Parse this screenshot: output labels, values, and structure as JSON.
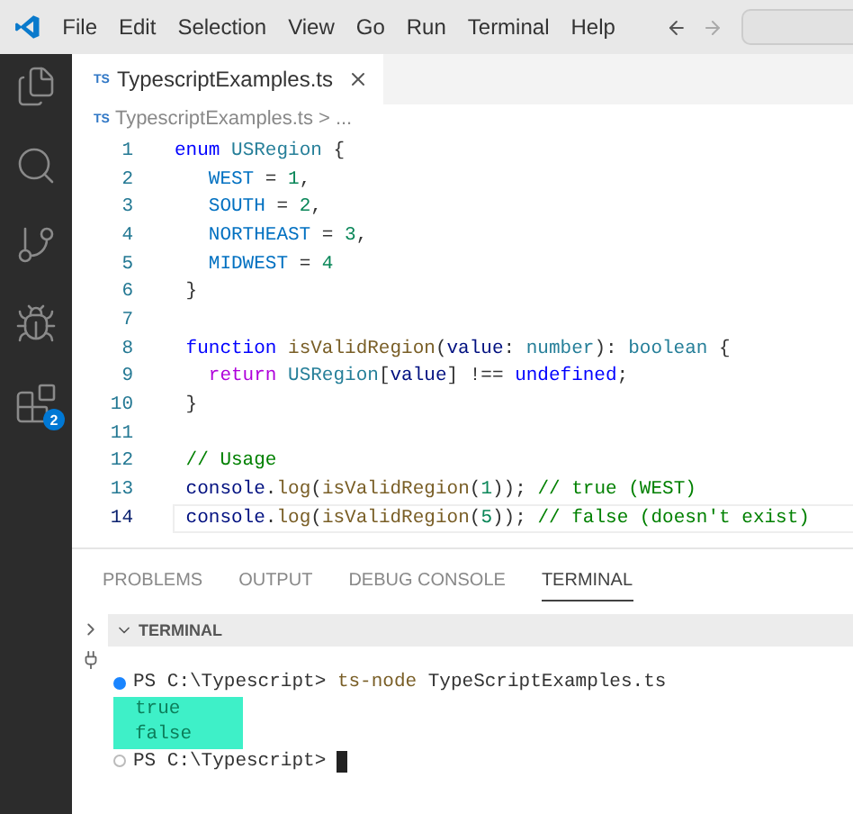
{
  "menu_bar": {
    "items": [
      "File",
      "Edit",
      "Selection",
      "View",
      "Go",
      "Run",
      "Terminal",
      "Help"
    ]
  },
  "activity_bar": {
    "items": [
      {
        "kind": "files",
        "selected": false
      },
      {
        "kind": "search",
        "selected": false
      },
      {
        "kind": "source-control",
        "selected": false
      },
      {
        "kind": "run",
        "selected": false
      },
      {
        "kind": "extensions",
        "selected": false,
        "badge": "2"
      }
    ]
  },
  "editor_tabs": [
    {
      "lang": "TS",
      "label": "TypescriptExamples.ts",
      "selected": true
    }
  ],
  "breadcrumbs": {
    "lang": "TS",
    "items": [
      "TypescriptExamples.ts",
      "..."
    ],
    "separator": ">"
  },
  "code": {
    "lines": [
      {
        "number": "1",
        "active": false,
        "tokens": [
          {
            "kind": "keyword",
            "text": "enum"
          },
          {
            "kind": "type",
            "text": " USRegion"
          },
          {
            "kind": "plain",
            "text": " {"
          }
        ]
      },
      {
        "number": "2",
        "active": false,
        "tokens": [
          {
            "kind": "member",
            "text": "   WEST"
          },
          {
            "kind": "plain",
            "text": " = "
          },
          {
            "kind": "number",
            "text": "1"
          },
          {
            "kind": "plain",
            "text": ","
          }
        ]
      },
      {
        "number": "3",
        "active": false,
        "tokens": [
          {
            "kind": "member",
            "text": "   SOUTH"
          },
          {
            "kind": "plain",
            "text": " = "
          },
          {
            "kind": "number",
            "text": "2"
          },
          {
            "kind": "plain",
            "text": ","
          }
        ]
      },
      {
        "number": "4",
        "active": false,
        "tokens": [
          {
            "kind": "member",
            "text": "   NORTHEAST"
          },
          {
            "kind": "plain",
            "text": " = "
          },
          {
            "kind": "number",
            "text": "3"
          },
          {
            "kind": "plain",
            "text": ","
          }
        ]
      },
      {
        "number": "5",
        "active": false,
        "tokens": [
          {
            "kind": "member",
            "text": "   MIDWEST"
          },
          {
            "kind": "plain",
            "text": " = "
          },
          {
            "kind": "number",
            "text": "4"
          }
        ]
      },
      {
        "number": "6",
        "active": false,
        "tokens": [
          {
            "kind": "plain",
            "text": " }"
          }
        ]
      },
      {
        "number": "7",
        "active": false
      },
      {
        "number": "8",
        "active": false,
        "tokens": [
          {
            "kind": "keyword",
            "text": " function"
          },
          {
            "kind": "function",
            "text": " isValidRegion"
          },
          {
            "kind": "plain",
            "text": "("
          },
          {
            "kind": "variable",
            "text": "value"
          },
          {
            "kind": "plain",
            "text": ": "
          },
          {
            "kind": "type",
            "text": "number"
          },
          {
            "kind": "plain",
            "text": "): "
          },
          {
            "kind": "type",
            "text": "boolean"
          },
          {
            "kind": "plain",
            "text": " {"
          }
        ]
      },
      {
        "number": "9",
        "active": false,
        "tokens": [
          {
            "kind": "control",
            "text": "   return"
          },
          {
            "kind": "type",
            "text": " USRegion"
          },
          {
            "kind": "plain",
            "text": "["
          },
          {
            "kind": "variable",
            "text": "value"
          },
          {
            "kind": "plain",
            "text": "] !== "
          },
          {
            "kind": "keyword",
            "text": "undefined"
          },
          {
            "kind": "plain",
            "text": ";"
          }
        ]
      },
      {
        "number": "10",
        "active": false,
        "tokens": [
          {
            "kind": "plain",
            "text": " }"
          }
        ]
      },
      {
        "number": "11",
        "active": false
      },
      {
        "number": "12",
        "active": false,
        "tokens": [
          {
            "kind": "comment",
            "text": " // Usage"
          }
        ]
      },
      {
        "number": "13",
        "active": false,
        "tokens": [
          {
            "kind": "variable",
            "text": " console"
          },
          {
            "kind": "plain",
            "text": "."
          },
          {
            "kind": "function",
            "text": "log"
          },
          {
            "kind": "plain",
            "text": "("
          },
          {
            "kind": "function",
            "text": "isValidRegion"
          },
          {
            "kind": "plain",
            "text": "("
          },
          {
            "kind": "number",
            "text": "1"
          },
          {
            "kind": "plain",
            "text": ")); "
          },
          {
            "kind": "comment",
            "text": "// true (WEST)"
          }
        ]
      },
      {
        "number": "14",
        "active": true,
        "tokens": [
          {
            "kind": "variable",
            "text": " console"
          },
          {
            "kind": "plain",
            "text": "."
          },
          {
            "kind": "function",
            "text": "log"
          },
          {
            "kind": "plain",
            "text": "("
          },
          {
            "kind": "function",
            "text": "isValidRegion"
          },
          {
            "kind": "plain",
            "text": "("
          },
          {
            "kind": "number",
            "text": "5"
          },
          {
            "kind": "plain",
            "text": ")); "
          },
          {
            "kind": "comment",
            "text": "// false (doesn't exist)"
          }
        ]
      }
    ]
  },
  "panel_tabs": [
    {
      "label": "PROBLEMS",
      "selected": false
    },
    {
      "label": "OUTPUT",
      "selected": false
    },
    {
      "label": "DEBUG CONSOLE",
      "selected": false
    },
    {
      "label": "TERMINAL",
      "selected": true
    }
  ],
  "terminal": {
    "header": "TERMINAL",
    "lines": [
      {
        "kind": "command",
        "prompt": "PS C:\\Typescript>",
        "program": "ts-node",
        "args": "TypeScriptExamples.ts"
      },
      {
        "kind": "output",
        "text": "true",
        "highlighted": true
      },
      {
        "kind": "output",
        "text": "false",
        "highlighted": true
      },
      {
        "kind": "prompt",
        "prompt": "PS C:\\Typescript>"
      }
    ]
  }
}
